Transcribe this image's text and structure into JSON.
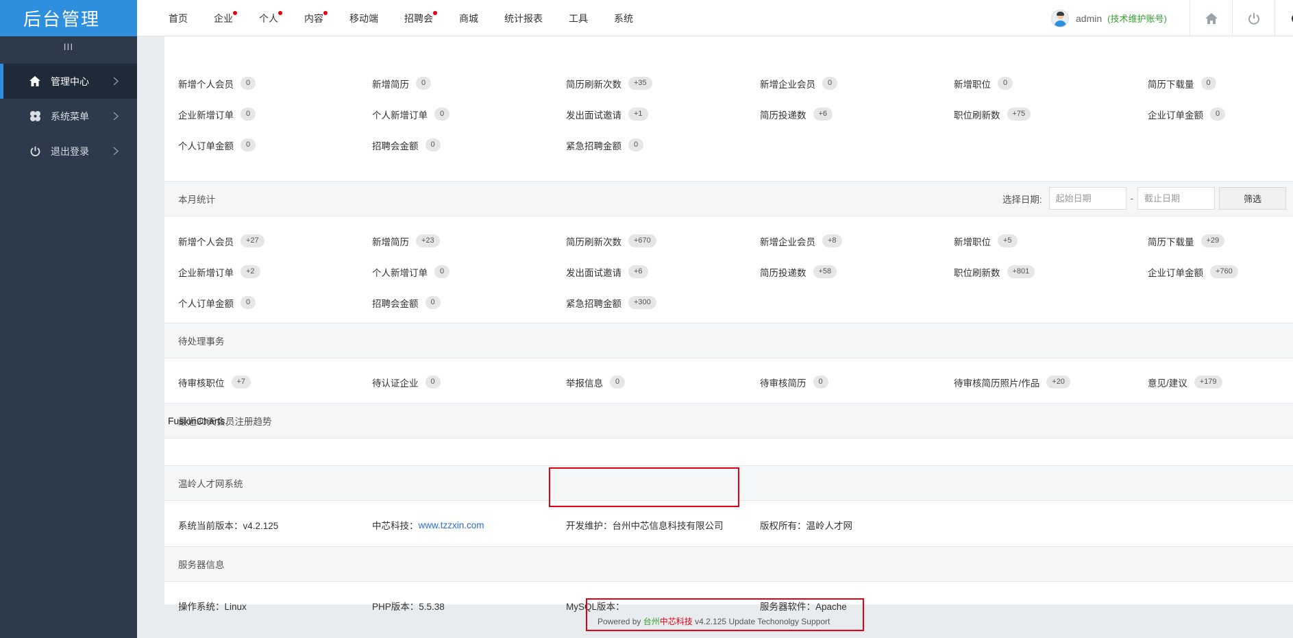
{
  "app": {
    "logo": "后台管理"
  },
  "topnav": [
    {
      "label": "首页",
      "active": true,
      "dot": false
    },
    {
      "label": "企业",
      "active": false,
      "dot": true
    },
    {
      "label": "个人",
      "active": false,
      "dot": true
    },
    {
      "label": "内容",
      "active": false,
      "dot": true
    },
    {
      "label": "移动端",
      "active": false,
      "dot": false
    },
    {
      "label": "招聘会",
      "active": false,
      "dot": true
    },
    {
      "label": "商城",
      "active": false,
      "dot": false
    },
    {
      "label": "统计报表",
      "active": false,
      "dot": false
    },
    {
      "label": "工具",
      "active": false,
      "dot": false
    },
    {
      "label": "系统",
      "active": false,
      "dot": false
    }
  ],
  "user": {
    "name": "admin",
    "role": "(技术维护账号)"
  },
  "sidebar": {
    "toggle": "III",
    "items": [
      {
        "label": "管理中心",
        "icon": "home-icon",
        "active": true
      },
      {
        "label": "系统菜单",
        "icon": "flower-icon",
        "active": false
      },
      {
        "label": "退出登录",
        "icon": "power-icon",
        "active": false
      }
    ]
  },
  "today_stats": [
    [
      {
        "label": "新增个人会员",
        "value": "0"
      },
      {
        "label": "新增简历",
        "value": "0"
      },
      {
        "label": "简历刷新次数",
        "value": "+35"
      },
      {
        "label": "新增企业会员",
        "value": "0"
      },
      {
        "label": "新增职位",
        "value": "0"
      },
      {
        "label": "简历下载量",
        "value": "0"
      }
    ],
    [
      {
        "label": "企业新增订单",
        "value": "0"
      },
      {
        "label": "个人新增订单",
        "value": "0"
      },
      {
        "label": "发出面试邀请",
        "value": "+1"
      },
      {
        "label": "简历投递数",
        "value": "+6"
      },
      {
        "label": "职位刷新数",
        "value": "+75"
      },
      {
        "label": "企业订单金额",
        "value": "0"
      }
    ],
    [
      {
        "label": "个人订单金额",
        "value": "0"
      },
      {
        "label": "招聘会金额",
        "value": "0"
      },
      {
        "label": "紧急招聘金额",
        "value": "0"
      }
    ]
  ],
  "month_section": {
    "title": "本月统计",
    "filter_label": "选择日期:",
    "start_placeholder": "起始日期",
    "end_placeholder": "截止日期",
    "separator": "-",
    "button": "筛选"
  },
  "month_stats": [
    [
      {
        "label": "新增个人会员",
        "value": "+27"
      },
      {
        "label": "新增简历",
        "value": "+23"
      },
      {
        "label": "简历刷新次数",
        "value": "+670"
      },
      {
        "label": "新增企业会员",
        "value": "+8"
      },
      {
        "label": "新增职位",
        "value": "+5"
      },
      {
        "label": "简历下载量",
        "value": "+29"
      }
    ],
    [
      {
        "label": "企业新增订单",
        "value": "+2"
      },
      {
        "label": "个人新增订单",
        "value": "0"
      },
      {
        "label": "发出面试邀请",
        "value": "+6"
      },
      {
        "label": "简历投递数",
        "value": "+58"
      },
      {
        "label": "职位刷新数",
        "value": "+801"
      },
      {
        "label": "企业订单金额",
        "value": "+760"
      }
    ],
    [
      {
        "label": "个人订单金额",
        "value": "0"
      },
      {
        "label": "招聘会金额",
        "value": "0"
      },
      {
        "label": "紧急招聘金额",
        "value": "+300"
      }
    ]
  ],
  "pending_section": {
    "title": "待处理事务"
  },
  "pending": [
    {
      "label": "待审核职位",
      "value": "+7"
    },
    {
      "label": "待认证企业",
      "value": "0"
    },
    {
      "label": "举报信息",
      "value": "0"
    },
    {
      "label": "待审核简历",
      "value": "0"
    },
    {
      "label": "待审核简历照片/作品",
      "value": "+20"
    },
    {
      "label": "意见/建议",
      "value": "+179"
    }
  ],
  "trend_section": {
    "title": "最近30天会员注册趋势",
    "chart_placeholder": "FusionCharts."
  },
  "system_section": {
    "title": "温岭人才网系统",
    "version_label": "系统当前版本：v4.2.125",
    "company_label": "中芯科技：",
    "company_link": "www.tzzxin.com",
    "developer": "开发维护：台州中芯信息科技有限公司",
    "copyright": "版权所有：温岭人才网"
  },
  "server_section": {
    "title": "服务器信息",
    "os": "操作系统：Linux",
    "php": "PHP版本：5.5.38",
    "mysql": "MySQL版本：",
    "server": "服务器软件：Apache"
  },
  "footer": {
    "prefix": "Powered by ",
    "brand_green": "台州",
    "brand_red": "中芯科技",
    "suffix": " v4.2.125 Update Techonolgy Support"
  },
  "colors": {
    "primary": "#2d8fde",
    "sidebar": "#2d3a4b",
    "highlight": "#e60012",
    "green": "#32a22f"
  }
}
